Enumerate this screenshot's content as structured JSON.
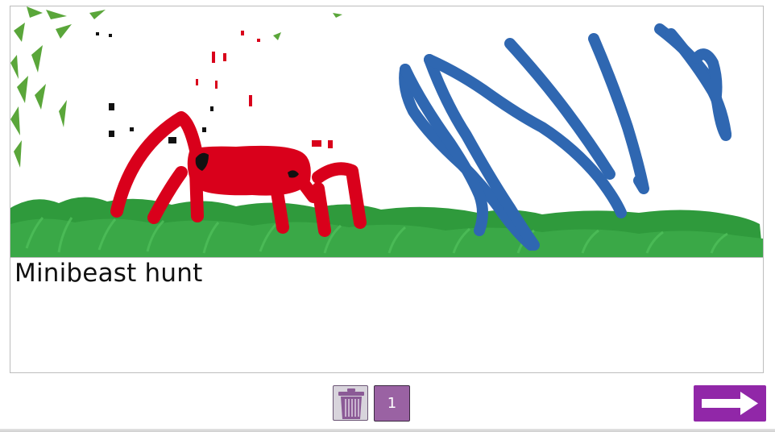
{
  "story": {
    "caption": "Minibeast hunt",
    "drawing_description_icon": "drawing-canvas"
  },
  "controls": {
    "delete_icon": "trash-icon",
    "page_number": "1",
    "next_icon": "arrow-right-icon"
  },
  "colors": {
    "accent": "#9127a8",
    "page_button": "#9a62a3",
    "spider_red": "#d9001b",
    "scribble_blue": "#2f67b1",
    "grass_green": "#2f9a3c"
  }
}
